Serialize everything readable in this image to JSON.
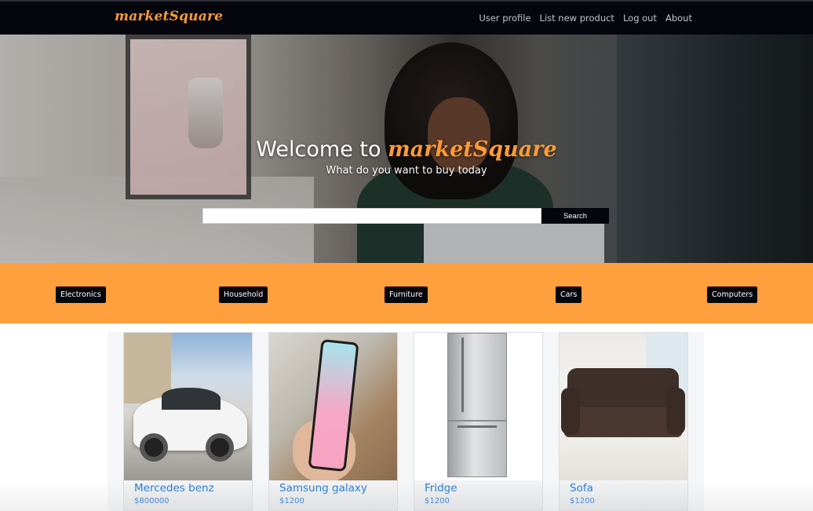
{
  "navbar": {
    "brand": "marketSquare",
    "links": [
      "User profile",
      "List new product",
      "Log out",
      "About"
    ]
  },
  "hero": {
    "title_prefix": "Welcome to",
    "title_brand": "marketSquare",
    "subtitle": "What do you want to buy today",
    "search_value": "",
    "search_button": "Search"
  },
  "categories": [
    "Electronics",
    "Household",
    "Furniture",
    "Cars",
    "Computers"
  ],
  "products": [
    {
      "name": "Mercedes benz",
      "price": "$800000"
    },
    {
      "name": "Samsung galaxy",
      "price": "$1200"
    },
    {
      "name": "Fridge",
      "price": "$1200"
    },
    {
      "name": "Sofa",
      "price": "$1200"
    }
  ],
  "colors": {
    "accent": "#ff9f3e",
    "navbar": "#05060d",
    "link": "#1976d2"
  }
}
